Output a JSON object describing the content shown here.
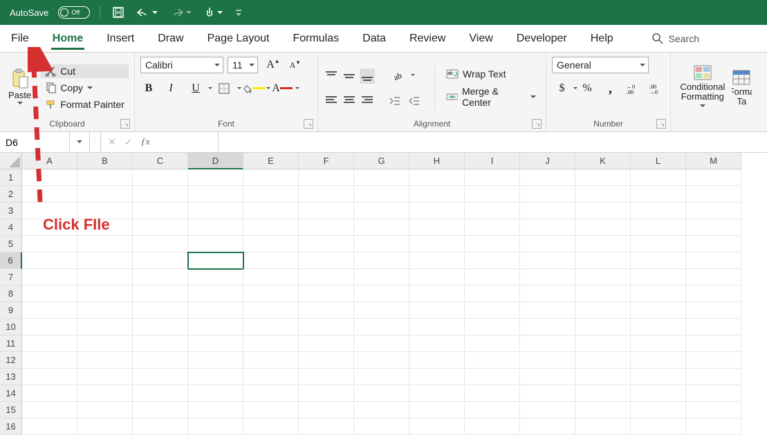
{
  "titlebar": {
    "autosave_label": "AutoSave",
    "autosave_state": "Off"
  },
  "tabs": {
    "file": "File",
    "home": "Home",
    "insert": "Insert",
    "draw": "Draw",
    "page_layout": "Page Layout",
    "formulas": "Formulas",
    "data": "Data",
    "review": "Review",
    "view": "View",
    "developer": "Developer",
    "help": "Help",
    "search": "Search"
  },
  "clipboard": {
    "paste": "Paste",
    "cut": "Cut",
    "copy": "Copy",
    "format_painter": "Format Painter",
    "group_label": "Clipboard"
  },
  "font": {
    "name": "Calibri",
    "size": "11",
    "group_label": "Font"
  },
  "alignment": {
    "wrap": "Wrap Text",
    "merge": "Merge & Center",
    "group_label": "Alignment"
  },
  "number": {
    "format": "General",
    "group_label": "Number"
  },
  "styles": {
    "conditional": "Conditional Formatting",
    "format_table": "Format as Table"
  },
  "name_box": "D6",
  "grid": {
    "cols": [
      "A",
      "B",
      "C",
      "D",
      "E",
      "F",
      "G",
      "H",
      "I",
      "J",
      "K",
      "L",
      "M"
    ],
    "rows": [
      "1",
      "2",
      "3",
      "4",
      "5",
      "6",
      "7",
      "8",
      "9",
      "10",
      "11",
      "12",
      "13",
      "14",
      "15",
      "16"
    ],
    "selected": {
      "col": "D",
      "row": "6"
    }
  },
  "annotation": {
    "text": "Click FIle",
    "color": "#d62f2f"
  }
}
